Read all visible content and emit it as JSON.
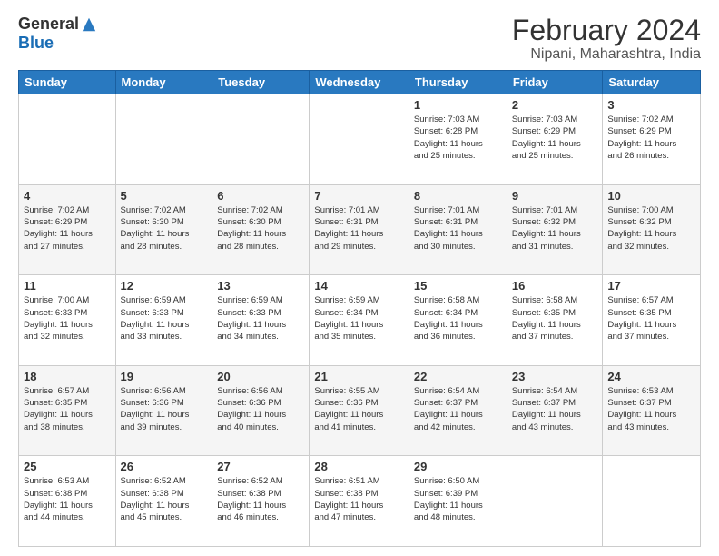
{
  "logo": {
    "general": "General",
    "blue": "Blue"
  },
  "title": "February 2024",
  "subtitle": "Nipani, Maharashtra, India",
  "days_of_week": [
    "Sunday",
    "Monday",
    "Tuesday",
    "Wednesday",
    "Thursday",
    "Friday",
    "Saturday"
  ],
  "weeks": [
    [
      {
        "day": "",
        "info": ""
      },
      {
        "day": "",
        "info": ""
      },
      {
        "day": "",
        "info": ""
      },
      {
        "day": "",
        "info": ""
      },
      {
        "day": "1",
        "info": "Sunrise: 7:03 AM\nSunset: 6:28 PM\nDaylight: 11 hours\nand 25 minutes."
      },
      {
        "day": "2",
        "info": "Sunrise: 7:03 AM\nSunset: 6:29 PM\nDaylight: 11 hours\nand 25 minutes."
      },
      {
        "day": "3",
        "info": "Sunrise: 7:02 AM\nSunset: 6:29 PM\nDaylight: 11 hours\nand 26 minutes."
      }
    ],
    [
      {
        "day": "4",
        "info": "Sunrise: 7:02 AM\nSunset: 6:29 PM\nDaylight: 11 hours\nand 27 minutes."
      },
      {
        "day": "5",
        "info": "Sunrise: 7:02 AM\nSunset: 6:30 PM\nDaylight: 11 hours\nand 28 minutes."
      },
      {
        "day": "6",
        "info": "Sunrise: 7:02 AM\nSunset: 6:30 PM\nDaylight: 11 hours\nand 28 minutes."
      },
      {
        "day": "7",
        "info": "Sunrise: 7:01 AM\nSunset: 6:31 PM\nDaylight: 11 hours\nand 29 minutes."
      },
      {
        "day": "8",
        "info": "Sunrise: 7:01 AM\nSunset: 6:31 PM\nDaylight: 11 hours\nand 30 minutes."
      },
      {
        "day": "9",
        "info": "Sunrise: 7:01 AM\nSunset: 6:32 PM\nDaylight: 11 hours\nand 31 minutes."
      },
      {
        "day": "10",
        "info": "Sunrise: 7:00 AM\nSunset: 6:32 PM\nDaylight: 11 hours\nand 32 minutes."
      }
    ],
    [
      {
        "day": "11",
        "info": "Sunrise: 7:00 AM\nSunset: 6:33 PM\nDaylight: 11 hours\nand 32 minutes."
      },
      {
        "day": "12",
        "info": "Sunrise: 6:59 AM\nSunset: 6:33 PM\nDaylight: 11 hours\nand 33 minutes."
      },
      {
        "day": "13",
        "info": "Sunrise: 6:59 AM\nSunset: 6:33 PM\nDaylight: 11 hours\nand 34 minutes."
      },
      {
        "day": "14",
        "info": "Sunrise: 6:59 AM\nSunset: 6:34 PM\nDaylight: 11 hours\nand 35 minutes."
      },
      {
        "day": "15",
        "info": "Sunrise: 6:58 AM\nSunset: 6:34 PM\nDaylight: 11 hours\nand 36 minutes."
      },
      {
        "day": "16",
        "info": "Sunrise: 6:58 AM\nSunset: 6:35 PM\nDaylight: 11 hours\nand 37 minutes."
      },
      {
        "day": "17",
        "info": "Sunrise: 6:57 AM\nSunset: 6:35 PM\nDaylight: 11 hours\nand 37 minutes."
      }
    ],
    [
      {
        "day": "18",
        "info": "Sunrise: 6:57 AM\nSunset: 6:35 PM\nDaylight: 11 hours\nand 38 minutes."
      },
      {
        "day": "19",
        "info": "Sunrise: 6:56 AM\nSunset: 6:36 PM\nDaylight: 11 hours\nand 39 minutes."
      },
      {
        "day": "20",
        "info": "Sunrise: 6:56 AM\nSunset: 6:36 PM\nDaylight: 11 hours\nand 40 minutes."
      },
      {
        "day": "21",
        "info": "Sunrise: 6:55 AM\nSunset: 6:36 PM\nDaylight: 11 hours\nand 41 minutes."
      },
      {
        "day": "22",
        "info": "Sunrise: 6:54 AM\nSunset: 6:37 PM\nDaylight: 11 hours\nand 42 minutes."
      },
      {
        "day": "23",
        "info": "Sunrise: 6:54 AM\nSunset: 6:37 PM\nDaylight: 11 hours\nand 43 minutes."
      },
      {
        "day": "24",
        "info": "Sunrise: 6:53 AM\nSunset: 6:37 PM\nDaylight: 11 hours\nand 43 minutes."
      }
    ],
    [
      {
        "day": "25",
        "info": "Sunrise: 6:53 AM\nSunset: 6:38 PM\nDaylight: 11 hours\nand 44 minutes."
      },
      {
        "day": "26",
        "info": "Sunrise: 6:52 AM\nSunset: 6:38 PM\nDaylight: 11 hours\nand 45 minutes."
      },
      {
        "day": "27",
        "info": "Sunrise: 6:52 AM\nSunset: 6:38 PM\nDaylight: 11 hours\nand 46 minutes."
      },
      {
        "day": "28",
        "info": "Sunrise: 6:51 AM\nSunset: 6:38 PM\nDaylight: 11 hours\nand 47 minutes."
      },
      {
        "day": "29",
        "info": "Sunrise: 6:50 AM\nSunset: 6:39 PM\nDaylight: 11 hours\nand 48 minutes."
      },
      {
        "day": "",
        "info": ""
      },
      {
        "day": "",
        "info": ""
      }
    ]
  ]
}
